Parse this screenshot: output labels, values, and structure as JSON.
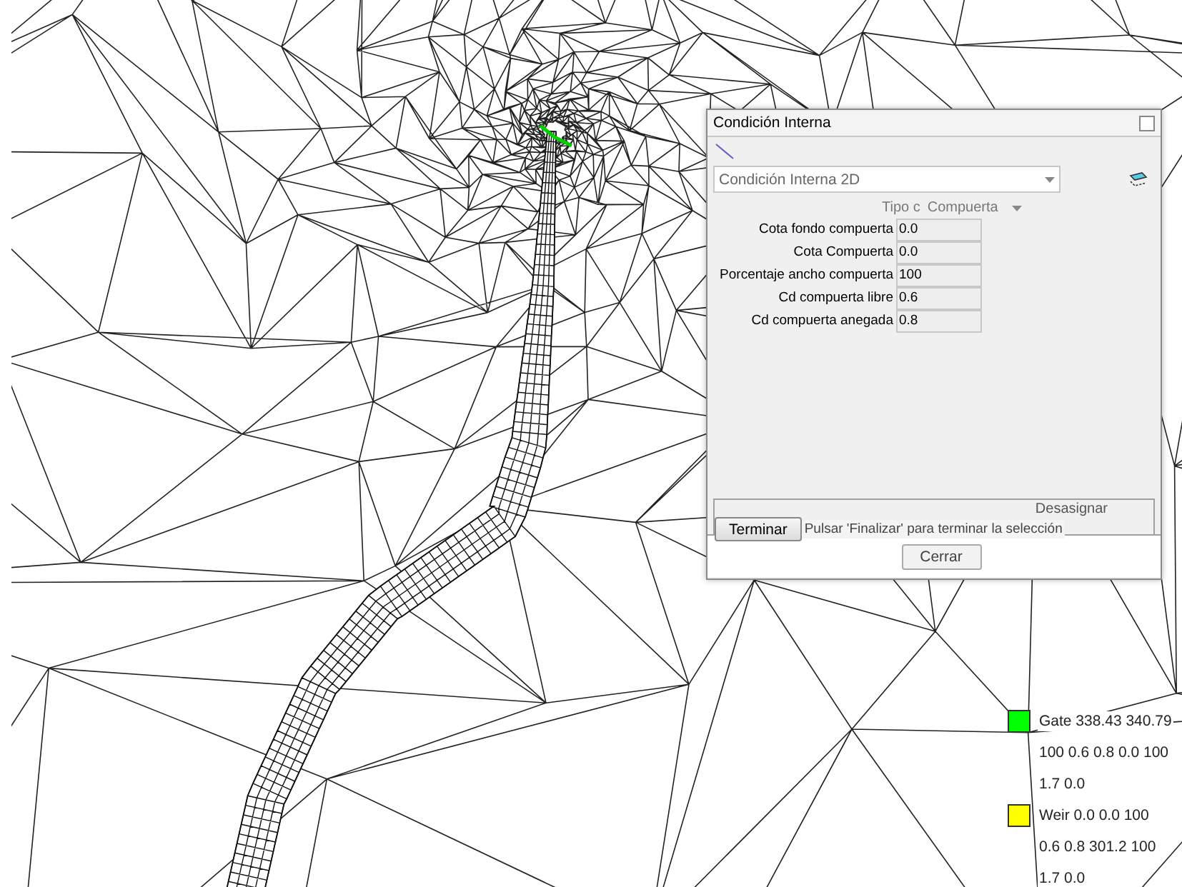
{
  "dialog": {
    "title": "Condición Interna",
    "type_select": {
      "value": "Condición Interna 2D"
    },
    "tipo": {
      "label": "Tipo c",
      "value": "Compuerta"
    },
    "fields": [
      {
        "label": "Cota fondo compuerta",
        "value": "0.0"
      },
      {
        "label": "Cota Compuerta",
        "value": "0.0"
      },
      {
        "label": "Porcentaje ancho compuerta",
        "value": "100"
      },
      {
        "label": "Cd compuerta libre",
        "value": "0.6"
      },
      {
        "label": "Cd compuerta anegada",
        "value": "0.8"
      }
    ],
    "tabs": [
      {
        "label": "Desasignar"
      }
    ],
    "terminar_button": "Terminar",
    "tooltip": "Pulsar 'Finalizar' para terminar la selección",
    "close_button": "Cerrar"
  },
  "legend": [
    {
      "color": "#00ff00",
      "lines": [
        "Gate 338.43 340.79",
        "100 0.6 0.8 0.0 100",
        "1.7 0.0"
      ]
    },
    {
      "color": "#ffff00",
      "lines": [
        "Weir 0.0 0.0 100",
        "0.6 0.8 301.2 100",
        "1.7 0.0"
      ]
    }
  ]
}
